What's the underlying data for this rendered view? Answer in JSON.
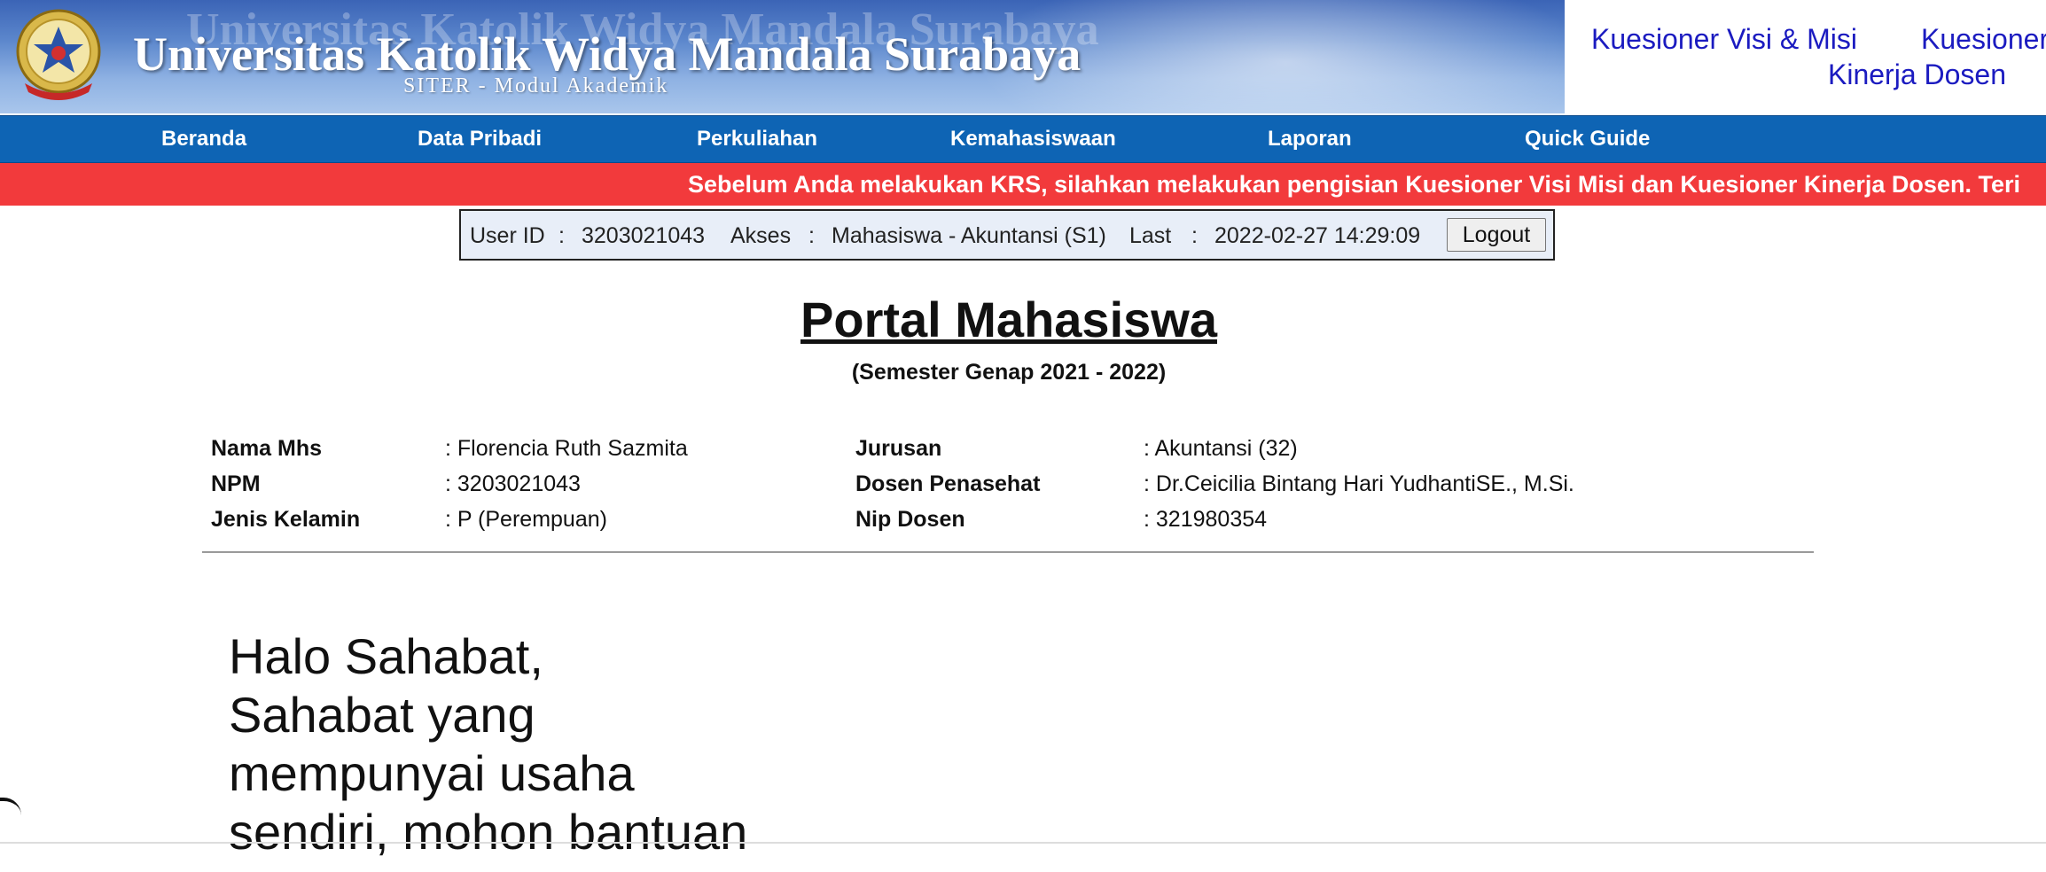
{
  "header": {
    "title": "Universitas Katolik Widya Mandala Surabaya",
    "subtitle": "SITER - Modul Akademik",
    "links": [
      "Kuesioner Visi & Misi",
      "Kuesioner",
      "Kinerja Dosen"
    ]
  },
  "nav": {
    "items": [
      "Beranda",
      "Data Pribadi",
      "Perkuliahan",
      "Kemahasiswaan",
      "Laporan",
      "Quick Guide"
    ]
  },
  "marquee": {
    "text": "Sebelum Anda melakukan KRS, silahkan melakukan pengisian Kuesioner Visi Misi dan Kuesioner Kinerja Dosen. Teri"
  },
  "userbar": {
    "userid_label": "User ID",
    "sep": ":",
    "userid": "3203021043",
    "akses_label": "Akses",
    "akses": "Mahasiswa - Akuntansi (S1)",
    "last_label": "Last",
    "last": "2022-02-27 14:29:09",
    "logout": "Logout"
  },
  "main": {
    "title": "Portal Mahasiswa",
    "semester": "(Semester Genap 2021 - 2022)",
    "info_left": [
      {
        "label": "Nama Mhs",
        "value": ": Florencia Ruth Sazmita"
      },
      {
        "label": "NPM",
        "value": ": 3203021043"
      },
      {
        "label": "Jenis Kelamin",
        "value": ": P (Perempuan)"
      }
    ],
    "info_right": [
      {
        "label": "Jurusan",
        "value": ": Akuntansi (32)"
      },
      {
        "label": "Dosen Penasehat",
        "value": ": Dr.Ceicilia Bintang Hari YudhantiSE., M.Si."
      },
      {
        "label": "Nip Dosen",
        "value": ": 321980354"
      }
    ],
    "content_lines": [
      "Halo Sahabat,",
      "Sahabat yang",
      "mempunyai usaha",
      "sendiri, mohon bantuan"
    ]
  },
  "colors": {
    "nav_bg": "#0e64b4",
    "marquee_bg": "#f23a3c",
    "link": "#1b1bc0",
    "userbar_bg": "#e8eef8"
  }
}
